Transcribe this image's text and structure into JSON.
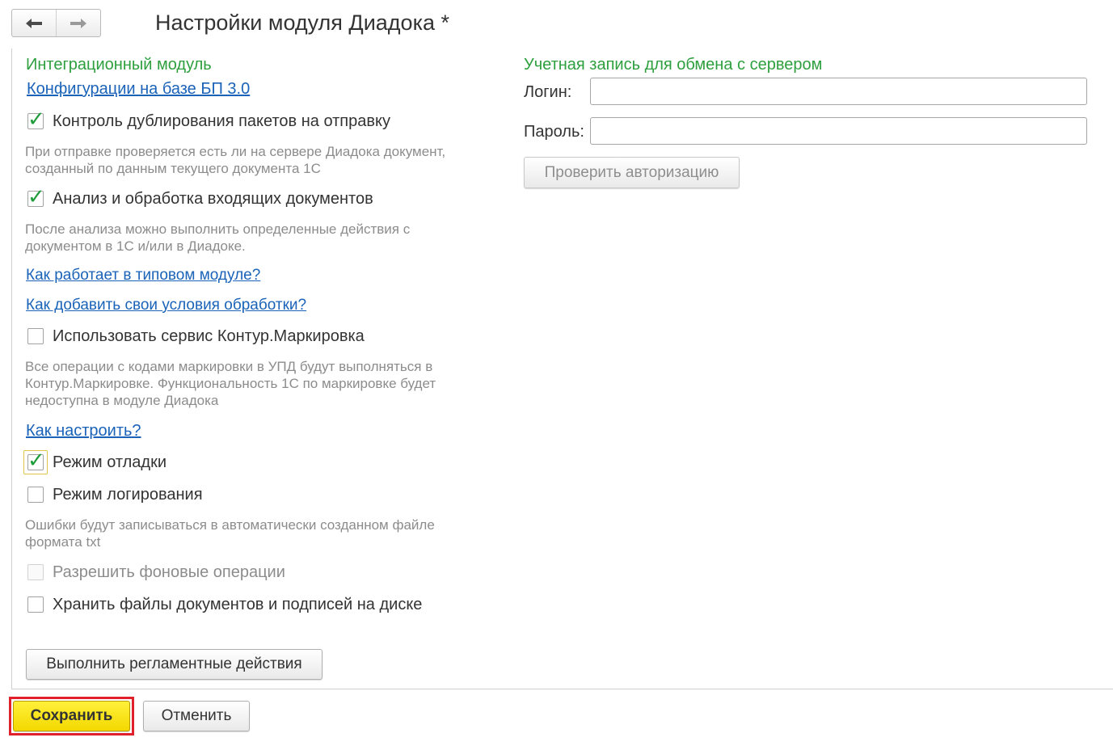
{
  "title": "Настройки модуля Диадока *",
  "nav": {
    "back_icon": "arrow-left",
    "forward_icon": "arrow-right"
  },
  "left": {
    "group_title": "Интеграционный модуль",
    "config_link": "Конфигурации на базе БП 3.0",
    "items": [
      {
        "label": "Контроль дублирования пакетов на отправку",
        "checked": true,
        "hint": [
          "При отправке проверяется есть ли на сервере Диадока документ,",
          "созданный по данным текущего документа 1С"
        ]
      },
      {
        "label": "Анализ и обработка входящих документов",
        "checked": true,
        "hint": [
          "После анализа можно выполнить определенные действия с",
          "документом в 1С и/или в Диадоке."
        ]
      },
      {
        "label": "Использовать сервис Контур.Маркировка",
        "checked": false,
        "hint": [
          "Все операции с кодами маркировки в УПД будут выполняться в",
          "Контур.Маркировке. Функциональность 1С по маркировке будет",
          "недоступна в модуле Диадока"
        ]
      },
      {
        "label": "Режим отладки",
        "checked": true
      },
      {
        "label": "Режим логирования",
        "checked": false,
        "hint": [
          "Ошибки будут записываться в автоматически созданном файле",
          "формата txt"
        ]
      },
      {
        "label": "Разрешить фоновые операции",
        "checked": false,
        "disabled": true
      },
      {
        "label": "Хранить файлы документов и подписей на диске",
        "checked": false
      }
    ],
    "links": {
      "how_works": "Как работает в типовом модуле?",
      "how_add": "Как добавить свои условия обработки?",
      "how_setup": "Как настроить?"
    },
    "routine_button": "Выполнить регламентные действия"
  },
  "right": {
    "group_title": "Учетная запись для обмена с сервером",
    "login_label": "Логин:",
    "login_value": "",
    "password_label": "Пароль:",
    "password_value": "",
    "check_auth_button": "Проверить авторизацию"
  },
  "footer": {
    "save_label": "Сохранить",
    "cancel_label": "Отменить"
  },
  "colors": {
    "group_title": "#2e9f3e",
    "link": "#1a63b8",
    "check": "#1f9d3a",
    "save_bg": "#f3d800",
    "save_highlight": "#e0202a"
  }
}
